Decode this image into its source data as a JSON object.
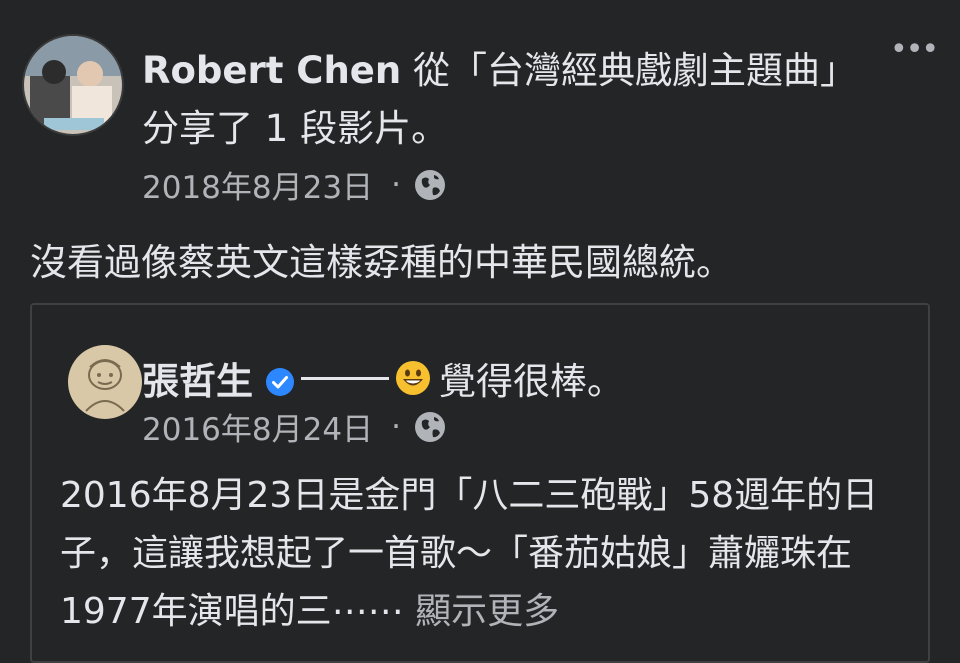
{
  "post": {
    "author": "Robert Chen",
    "action_text": " 從「台灣經典戲劇主題曲」分享了 1 段影片。",
    "date": "2018年8月23日",
    "separator": "·",
    "audience_icon": "globe-icon",
    "more_icon": "more-options-icon",
    "more_glyph": "•••",
    "message": "沒看過像蔡英文這樣孬種的中華民國總統。"
  },
  "shared": {
    "author": "張哲生",
    "verified_icon": "verified-badge-icon",
    "emoji_icon": "smiling-face-icon",
    "feeling_text": "覺得很棒。",
    "date": "2016年8月24日",
    "separator": "·",
    "audience_icon": "globe-icon",
    "body_text": "2016年8月23日是金門「八二三砲戰」58週年的日子，這讓我想起了一首歌～「番茄姑娘」蕭孋珠在1977年演唱的三⋯⋯",
    "see_more": "顯示更多"
  },
  "colors": {
    "background": "#242526",
    "text_primary": "#e4e6eb",
    "text_secondary": "#b0b3b8",
    "border": "#3e4042",
    "verified_blue": "#2d88ff",
    "emoji_yellow": "#f7c02f"
  }
}
